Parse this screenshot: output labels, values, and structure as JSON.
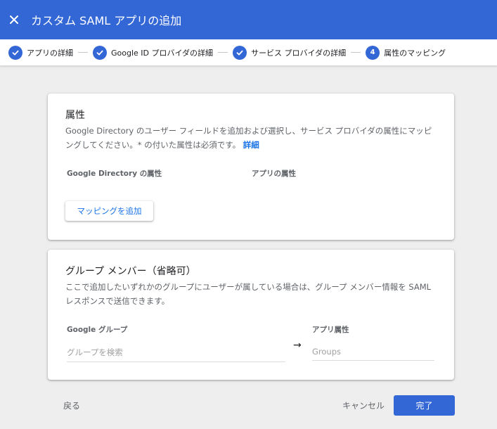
{
  "header": {
    "title": "カスタム SAML アプリの追加",
    "close_icon": "close-icon"
  },
  "stepper": {
    "steps": [
      {
        "label": "アプリの詳細",
        "state": "done"
      },
      {
        "label": "Google ID プロバイダの詳細",
        "state": "done"
      },
      {
        "label": "サービス プロバイダの詳細",
        "state": "done"
      },
      {
        "label": "属性のマッピング",
        "state": "current",
        "number": "4"
      }
    ]
  },
  "attributes_card": {
    "title": "属性",
    "description": "Google Directory のユーザー フィールドを追加および選択し、サービス プロバイダの属性にマッピングしてください。* の付いた属性は必須です。",
    "learn_more": "詳細",
    "col_directory": "Google Directory の属性",
    "col_app": "アプリの属性",
    "add_mapping_label": "マッピングを追加"
  },
  "group_card": {
    "title": "グループ メンバー（省略可）",
    "description": "ここで追加したいずれかのグループにユーザーが属している場合は、グループ メンバー情報を SAML レスポンスで送信できます。",
    "col_group": "Google グループ",
    "col_app_attr": "アプリ属性",
    "group_search_placeholder": "グループを検索",
    "app_attr_placeholder": "Groups",
    "arrow": "→"
  },
  "footer": {
    "back_label": "戻る",
    "cancel_label": "キャンセル",
    "done_label": "完了"
  },
  "colors": {
    "primary": "#3367d6",
    "link": "#1a73e8",
    "background": "#eeeeee"
  }
}
